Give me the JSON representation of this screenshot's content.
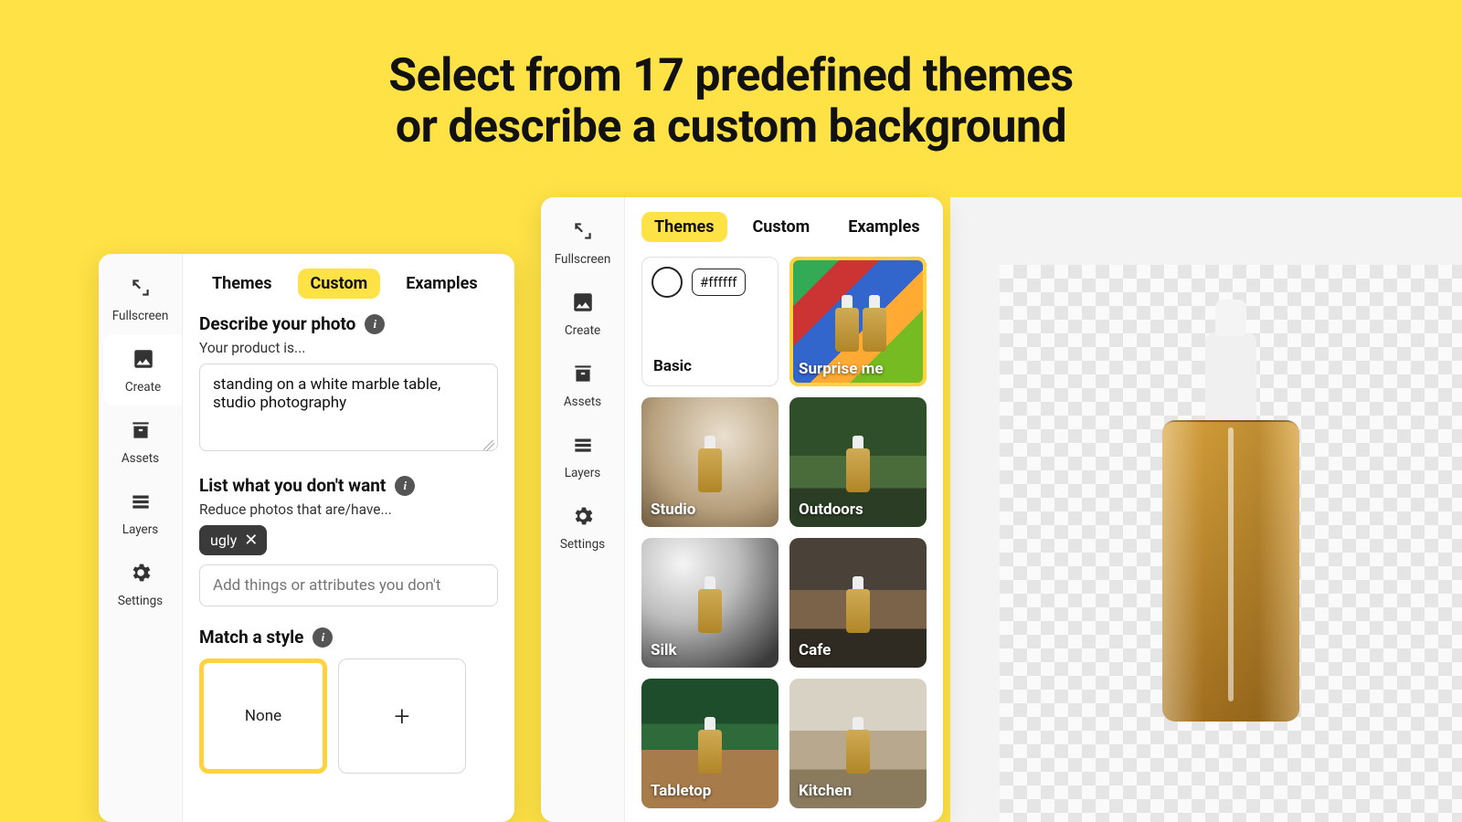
{
  "headline_line1": "Select from 17 predefined themes",
  "headline_line2": "or describe a custom background",
  "sidebar": {
    "fullscreen": "Fullscreen",
    "create": "Create",
    "assets": "Assets",
    "layers": "Layers",
    "settings": "Settings"
  },
  "tabs": {
    "themes": "Themes",
    "custom": "Custom",
    "examples": "Examples"
  },
  "custom_panel": {
    "describe_title": "Describe your photo",
    "describe_sub": "Your product is...",
    "describe_value": "standing on a white marble table, studio photography",
    "exclude_title": "List what you don't want",
    "exclude_sub": "Reduce photos that are/have...",
    "exclude_chip": "ugly",
    "exclude_placeholder": "Add things or attributes you don't",
    "style_title": "Match a style",
    "style_none": "None"
  },
  "themes_panel": {
    "basic_label": "Basic",
    "basic_hex": "#ffffff",
    "items": [
      "Surprise me",
      "Studio",
      "Outdoors",
      "Silk",
      "Cafe",
      "Tabletop",
      "Kitchen"
    ]
  }
}
